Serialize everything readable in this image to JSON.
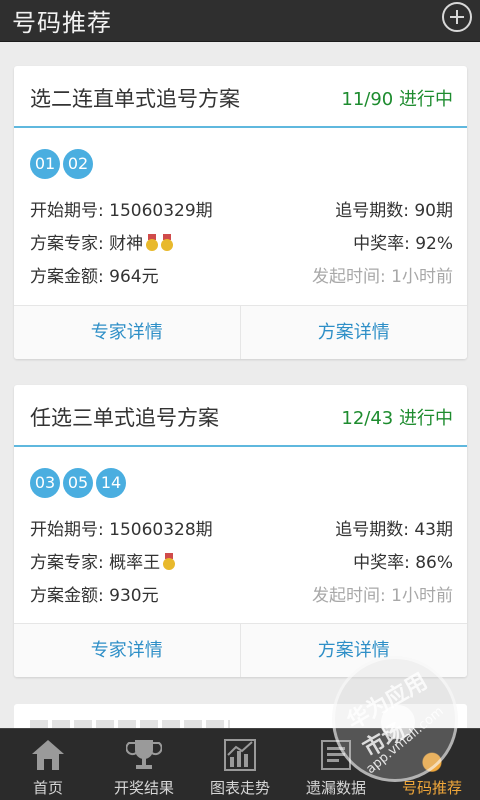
{
  "header": {
    "title": "号码推荐",
    "add_icon": "plus-circle-icon"
  },
  "cards": [
    {
      "name": "选二连直单式追号方案",
      "progress": "11/90 进行中",
      "balls": [
        "01",
        "02"
      ],
      "start_issue": "开始期号: 15060329期",
      "chase_count": "追号期数: 90期",
      "expert": "方案专家: 财神",
      "expert_medals": 2,
      "win_rate": "中奖率: 92%",
      "amount": "方案金额: 964元",
      "time": "发起时间: 1小时前",
      "btn_expert": "专家详情",
      "btn_plan": "方案详情"
    },
    {
      "name": "任选三单式追号方案",
      "progress": "12/43 进行中",
      "balls": [
        "03",
        "05",
        "14"
      ],
      "start_issue": "开始期号: 15060328期",
      "chase_count": "追号期数: 43期",
      "expert": "方案专家: 概率王",
      "expert_medals": 1,
      "win_rate": "中奖率: 86%",
      "amount": "方案金额: 930元",
      "time": "发起时间: 1小时前",
      "btn_expert": "专家详情",
      "btn_plan": "方案详情"
    }
  ],
  "tabs": [
    {
      "label": "首页",
      "icon": "home-icon"
    },
    {
      "label": "开奖结果",
      "icon": "trophy-icon"
    },
    {
      "label": "图表走势",
      "icon": "chart-icon"
    },
    {
      "label": "遗漏数据",
      "icon": "data-icon"
    },
    {
      "label": "号码推荐",
      "icon": "recommend-icon",
      "active": true
    }
  ],
  "watermark": {
    "text": "华为应用市场",
    "url": "app.vmall.com"
  },
  "colors": {
    "accent": "#4aaee0",
    "progress": "#1e8c2f",
    "link": "#2e8fc7",
    "active_tab": "#f0a73a"
  }
}
